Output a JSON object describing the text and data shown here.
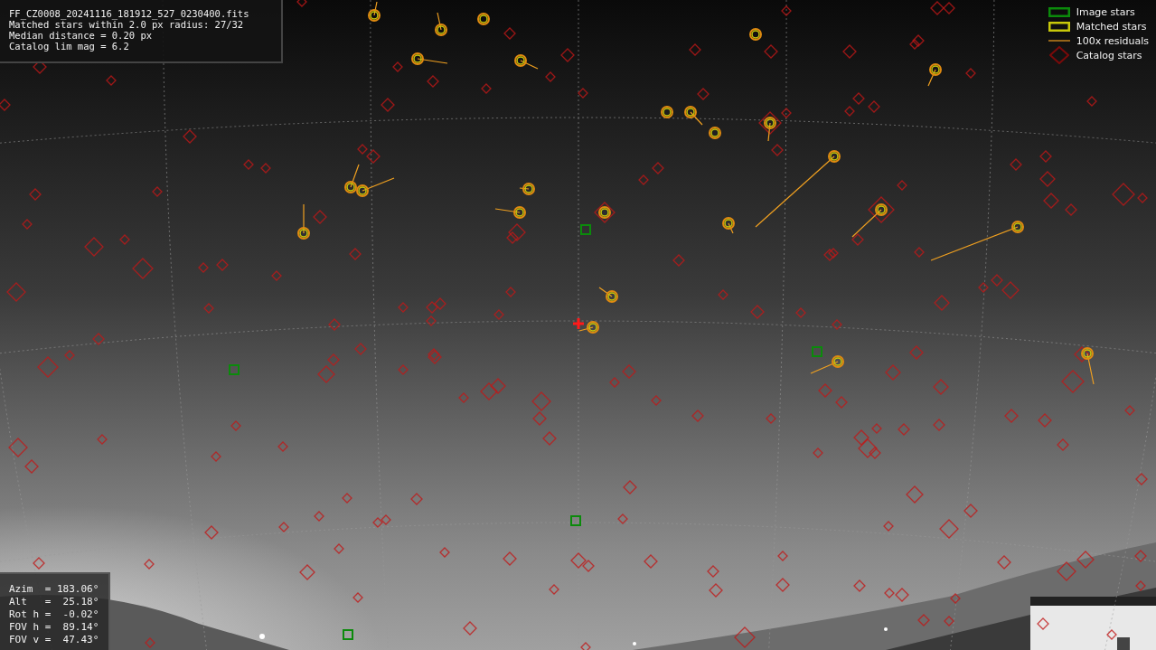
{
  "info_box": {
    "lines": [
      "FF_CZ0008_20241116_181912_527_0230400.fits",
      "Matched stars within 2.0 px radius: 27/32",
      "Median distance = 0.20 px",
      "Catalog lim mag = 6.2"
    ]
  },
  "legend": [
    {
      "label": "Image stars"
    },
    {
      "kind": "matched",
      "label": "Matched stars"
    },
    {
      "kind": "residual",
      "label": "100x residuals"
    },
    {
      "kind": "catalog",
      "label": "Catalog stars"
    }
  ],
  "pointing_box": {
    "lines": [
      "Azim  = 183.06°",
      "Alt   =  25.18°",
      "Rot h =  -0.02°",
      "FOV h =  89.14°",
      "FOV v =  47.43°"
    ]
  }
}
